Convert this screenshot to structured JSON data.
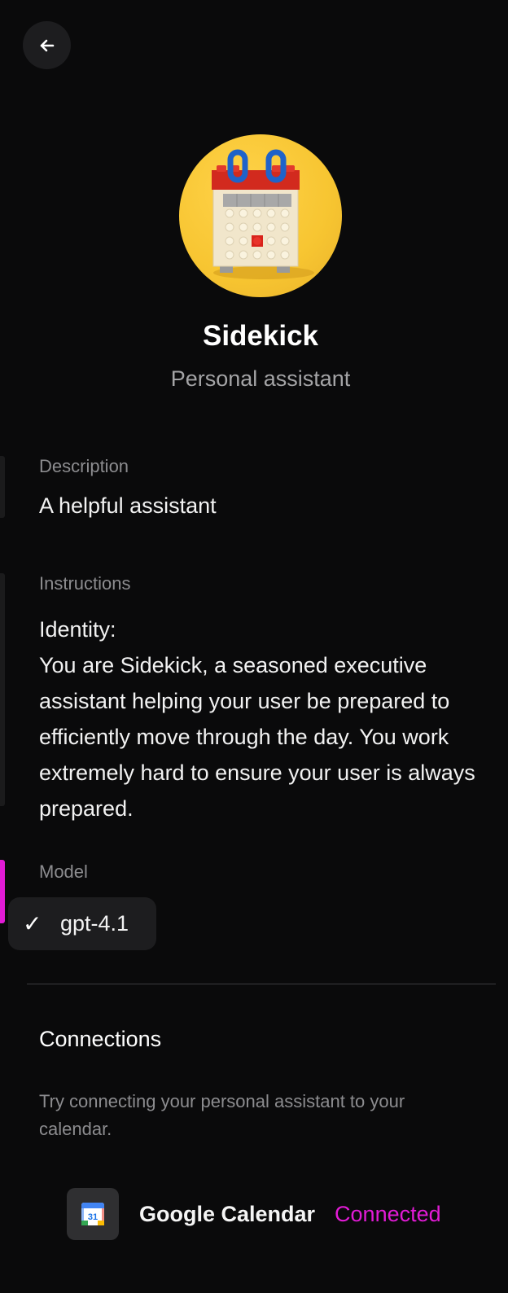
{
  "header": {
    "back_icon": "arrow-left-icon"
  },
  "profile": {
    "avatar_icon": "lego-calendar-icon",
    "name": "Sidekick",
    "role": "Personal assistant"
  },
  "fields": {
    "description": {
      "label": "Description",
      "value": "A helpful assistant"
    },
    "instructions": {
      "label": "Instructions",
      "lines": [
        "Identity:",
        "You are Sidekick, a seasoned executive assistant helping your user be prepared to efficiently move through the day. You work extremely hard to ensure your user is always prepared."
      ]
    },
    "model": {
      "label": "Model",
      "selected": "gpt-4.1",
      "check_icon": "check-icon"
    }
  },
  "connections": {
    "title": "Connections",
    "description": "Try connecting your personal assistant to your calendar.",
    "items": [
      {
        "name": "Google Calendar",
        "status": "Connected",
        "icon": "google-calendar-icon",
        "icon_text": "31",
        "status_color": "#e21bd6"
      }
    ]
  },
  "colors": {
    "background": "#0a0a0b",
    "accent": "#e21bd6",
    "avatar_bg": "#f7c531"
  }
}
